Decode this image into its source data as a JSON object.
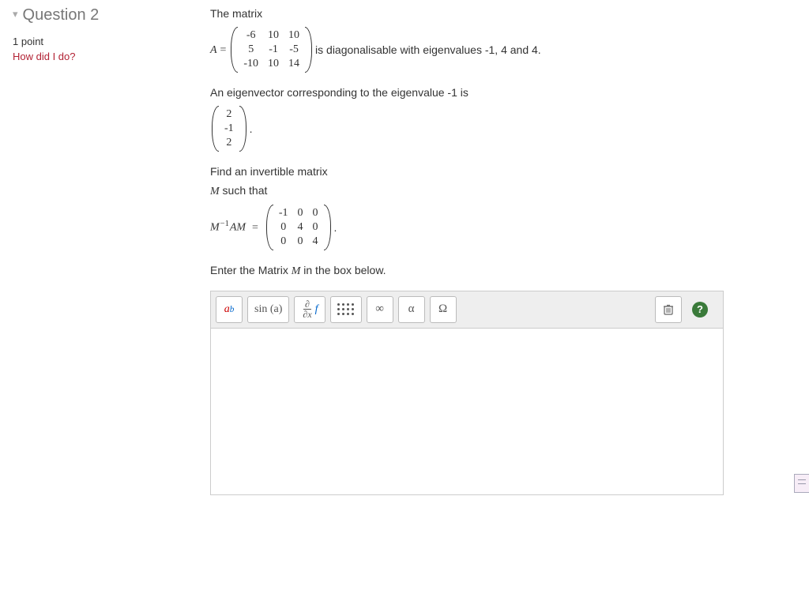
{
  "sidebar": {
    "title": "Question 2",
    "points": "1 point",
    "how_did": "How did I do?"
  },
  "question": {
    "intro": "The matrix",
    "A_label": "A",
    "eq": "=",
    "A_rows": [
      [
        "-6",
        "10",
        "10"
      ],
      [
        "5",
        "-1",
        "-5"
      ],
      [
        "-10",
        "10",
        "14"
      ]
    ],
    "diag_text": "is diagonalisable with eigenvalues -1, 4 and 4.",
    "eigen_intro": "An eigenvector corresponding to the eigenvalue -1 is",
    "eigenvector": [
      "2",
      "-1",
      "2"
    ],
    "period": ".",
    "find_text": "Find an invertible matrix",
    "M_such": "M",
    "such_that": " such that",
    "Minv_label_pre": "M",
    "Minv_label_exp": "−1",
    "Minv_label_post": "AM",
    "D_rows": [
      [
        "-1",
        "0",
        "0"
      ],
      [
        "0",
        "4",
        "0"
      ],
      [
        "0",
        "0",
        "4"
      ]
    ],
    "enter_text_pre": "Enter the Matrix ",
    "enter_text_M": "M",
    "enter_text_post": "  in the box below."
  },
  "toolbar": {
    "ab": {
      "a": "a",
      "b": "b"
    },
    "sin": "sin (a)",
    "frac_num": "∂",
    "frac_den": "∂x",
    "frac_side": "f",
    "inf": "∞",
    "alpha": "α",
    "omega": "Ω"
  }
}
